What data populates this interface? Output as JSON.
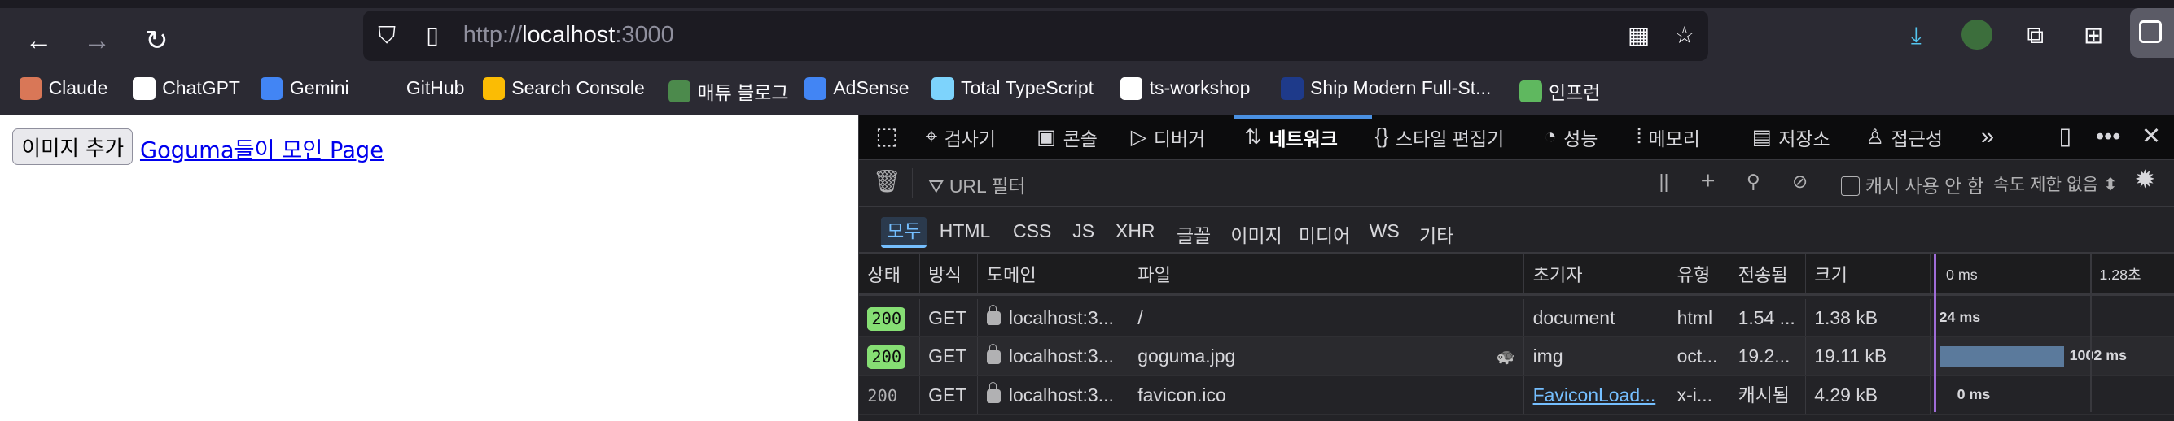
{
  "browser": {
    "url_prefix": "http://",
    "url_host": "localhost",
    "url_suffix": ":3000",
    "bookmarks": [
      {
        "label": "Claude",
        "icon": "claude-icon",
        "color": "#d97757"
      },
      {
        "label": "ChatGPT",
        "icon": "chatgpt-icon",
        "color": "#ffffff"
      },
      {
        "label": "Gemini",
        "icon": "gemini-icon",
        "color": "#4285f4"
      },
      {
        "label": "GitHub",
        "icon": "github-icon",
        "color": "#2b2a33"
      },
      {
        "label": "Search Console",
        "icon": "search-console-icon",
        "color": "#fbbc04"
      },
      {
        "label": "매튜 블로그",
        "icon": "blog-icon",
        "color": "#4c8a4c"
      },
      {
        "label": "AdSense",
        "icon": "adsense-icon",
        "color": "#4285f4"
      },
      {
        "label": "Total TypeScript",
        "icon": "diamond-icon",
        "color": "#7dd3fc"
      },
      {
        "label": "ts-workshop",
        "icon": "github-icon",
        "color": "#ffffff"
      },
      {
        "label": "Ship Modern Full-St...",
        "icon": "ship-icon",
        "color": "#1e3a8a"
      },
      {
        "label": "인프런",
        "icon": "inflearn-icon",
        "color": "#5fb85f"
      }
    ]
  },
  "page": {
    "add_button": "이미지 추가",
    "link": "Goguma들이 모인 Page"
  },
  "devtools": {
    "tabs": [
      {
        "label": "검사기",
        "icon": "inspector-icon"
      },
      {
        "label": "콘솔",
        "icon": "console-icon"
      },
      {
        "label": "디버거",
        "icon": "debugger-icon"
      },
      {
        "label": "네트워크",
        "icon": "network-icon"
      },
      {
        "label": "스타일 편집기",
        "icon": "style-editor-icon"
      },
      {
        "label": "성능",
        "icon": "performance-icon"
      },
      {
        "label": "메모리",
        "icon": "memory-icon"
      },
      {
        "label": "저장소",
        "icon": "storage-icon"
      },
      {
        "label": "접근성",
        "icon": "accessibility-icon"
      }
    ],
    "filter_placeholder": "URL 필터",
    "disable_cache": "캐시 사용 안 함",
    "throttle": "속도 제한 없음",
    "types": [
      "모두",
      "HTML",
      "CSS",
      "JS",
      "XHR",
      "글꼴",
      "이미지",
      "미디어",
      "WS",
      "기타"
    ],
    "columns": [
      "상태",
      "방식",
      "도메인",
      "파일",
      "초기자",
      "유형",
      "전송됨",
      "크기",
      "0 ms",
      "1.28초"
    ],
    "rows": [
      {
        "status": "200",
        "method": "GET",
        "domain": "localhost:3...",
        "file": "/",
        "initiator": "document",
        "type": "html",
        "transferred": "1.54 ...",
        "size": "1.38 kB",
        "timing": "24 ms"
      },
      {
        "status": "200",
        "method": "GET",
        "domain": "localhost:3...",
        "file": "goguma.jpg",
        "initiator": "img",
        "type": "oct...",
        "transferred": "19.2...",
        "size": "19.11 kB",
        "timing": "1002 ms",
        "throttled": true
      },
      {
        "status": "200",
        "method": "GET",
        "domain": "localhost:3...",
        "file": "favicon.ico",
        "initiator": "FaviconLoad...",
        "type": "x-i...",
        "transferred": "캐시됨",
        "size": "4.29 kB",
        "timing": "0 ms",
        "cached": true
      }
    ],
    "colors": {
      "accent": "#75bfff",
      "status_ok": "#86de74",
      "bar": "#5b7a9c"
    }
  }
}
